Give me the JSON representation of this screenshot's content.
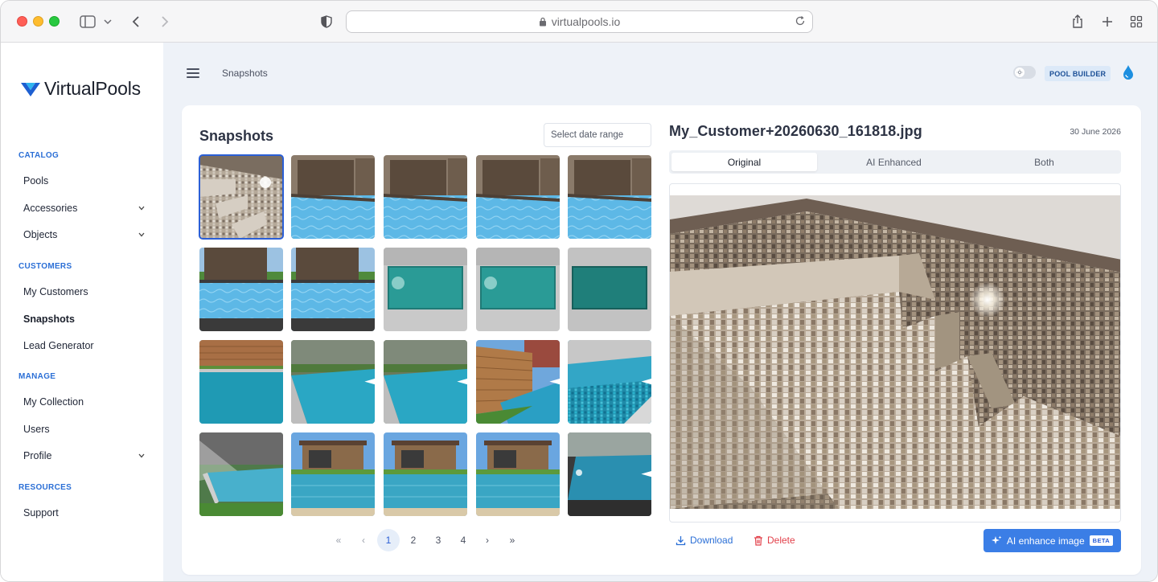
{
  "browser": {
    "url": "virtualpools.io"
  },
  "sidebar": {
    "logo_text": "VirtualPools",
    "sections": [
      {
        "title": "CATALOG",
        "items": [
          {
            "label": "Pools",
            "chevron": false,
            "active": false
          },
          {
            "label": "Accessories",
            "chevron": true,
            "active": false
          },
          {
            "label": "Objects",
            "chevron": true,
            "active": false
          }
        ]
      },
      {
        "title": "CUSTOMERS",
        "items": [
          {
            "label": "My Customers",
            "chevron": false,
            "active": false
          },
          {
            "label": "Snapshots",
            "chevron": false,
            "active": true
          },
          {
            "label": "Lead Generator",
            "chevron": false,
            "active": false
          }
        ]
      },
      {
        "title": "MANAGE",
        "items": [
          {
            "label": "My Collection",
            "chevron": false,
            "active": false
          },
          {
            "label": "Users",
            "chevron": false,
            "active": false
          },
          {
            "label": "Profile",
            "chevron": true,
            "active": false
          }
        ]
      },
      {
        "title": "RESOURCES",
        "items": [
          {
            "label": "Support",
            "chevron": false,
            "active": false
          }
        ]
      }
    ]
  },
  "header": {
    "breadcrumb": "Snapshots",
    "badge": "POOL BUILDER"
  },
  "gallery": {
    "title": "Snapshots",
    "date_placeholder": "Select date range",
    "thumbnails": [
      {
        "kind": "steps",
        "ai": false,
        "selected": true
      },
      {
        "kind": "wall-pool",
        "ai": false,
        "selected": false
      },
      {
        "kind": "wall-pool",
        "ai": false,
        "selected": false
      },
      {
        "kind": "wall-pool",
        "ai": false,
        "selected": false
      },
      {
        "kind": "wall-pool",
        "ai": false,
        "selected": false
      },
      {
        "kind": "garden-pool",
        "ai": false,
        "selected": false
      },
      {
        "kind": "garden-pool",
        "ai": false,
        "selected": false
      },
      {
        "kind": "teal-box",
        "ai": false,
        "selected": false
      },
      {
        "kind": "teal-box",
        "ai": false,
        "selected": false
      },
      {
        "kind": "teal-box-dark",
        "ai": false,
        "selected": false
      },
      {
        "kind": "fence-pool",
        "ai": false,
        "selected": false
      },
      {
        "kind": "garden-ai",
        "ai": true,
        "selected": false
      },
      {
        "kind": "garden-ai",
        "ai": true,
        "selected": false
      },
      {
        "kind": "fence-ai",
        "ai": true,
        "selected": false
      },
      {
        "kind": "mosaic-pool",
        "ai": true,
        "selected": false
      },
      {
        "kind": "sunny-pool",
        "ai": false,
        "selected": false
      },
      {
        "kind": "house-pool",
        "ai": false,
        "selected": false
      },
      {
        "kind": "house-pool",
        "ai": false,
        "selected": false
      },
      {
        "kind": "house-pool",
        "ai": false,
        "selected": false
      },
      {
        "kind": "dark-pool",
        "ai": true,
        "selected": false
      }
    ],
    "pagination": {
      "first": "«",
      "prev": "‹",
      "pages": [
        "1",
        "2",
        "3",
        "4"
      ],
      "current": "1",
      "next": "›",
      "last": "»"
    }
  },
  "detail": {
    "file_name": "My_Customer+20260630_161818.jpg",
    "date": "30 June 2026",
    "tabs": [
      "Original",
      "AI Enhanced",
      "Both"
    ],
    "active_tab": "Original",
    "download_label": "Download",
    "delete_label": "Delete",
    "enhance_label": "AI enhance image",
    "beta_label": "BETA"
  },
  "colors": {
    "accent": "#3b7ee6",
    "section_title": "#2b6fd6",
    "danger": "#e2404a",
    "main_bg": "#eef2f8"
  }
}
